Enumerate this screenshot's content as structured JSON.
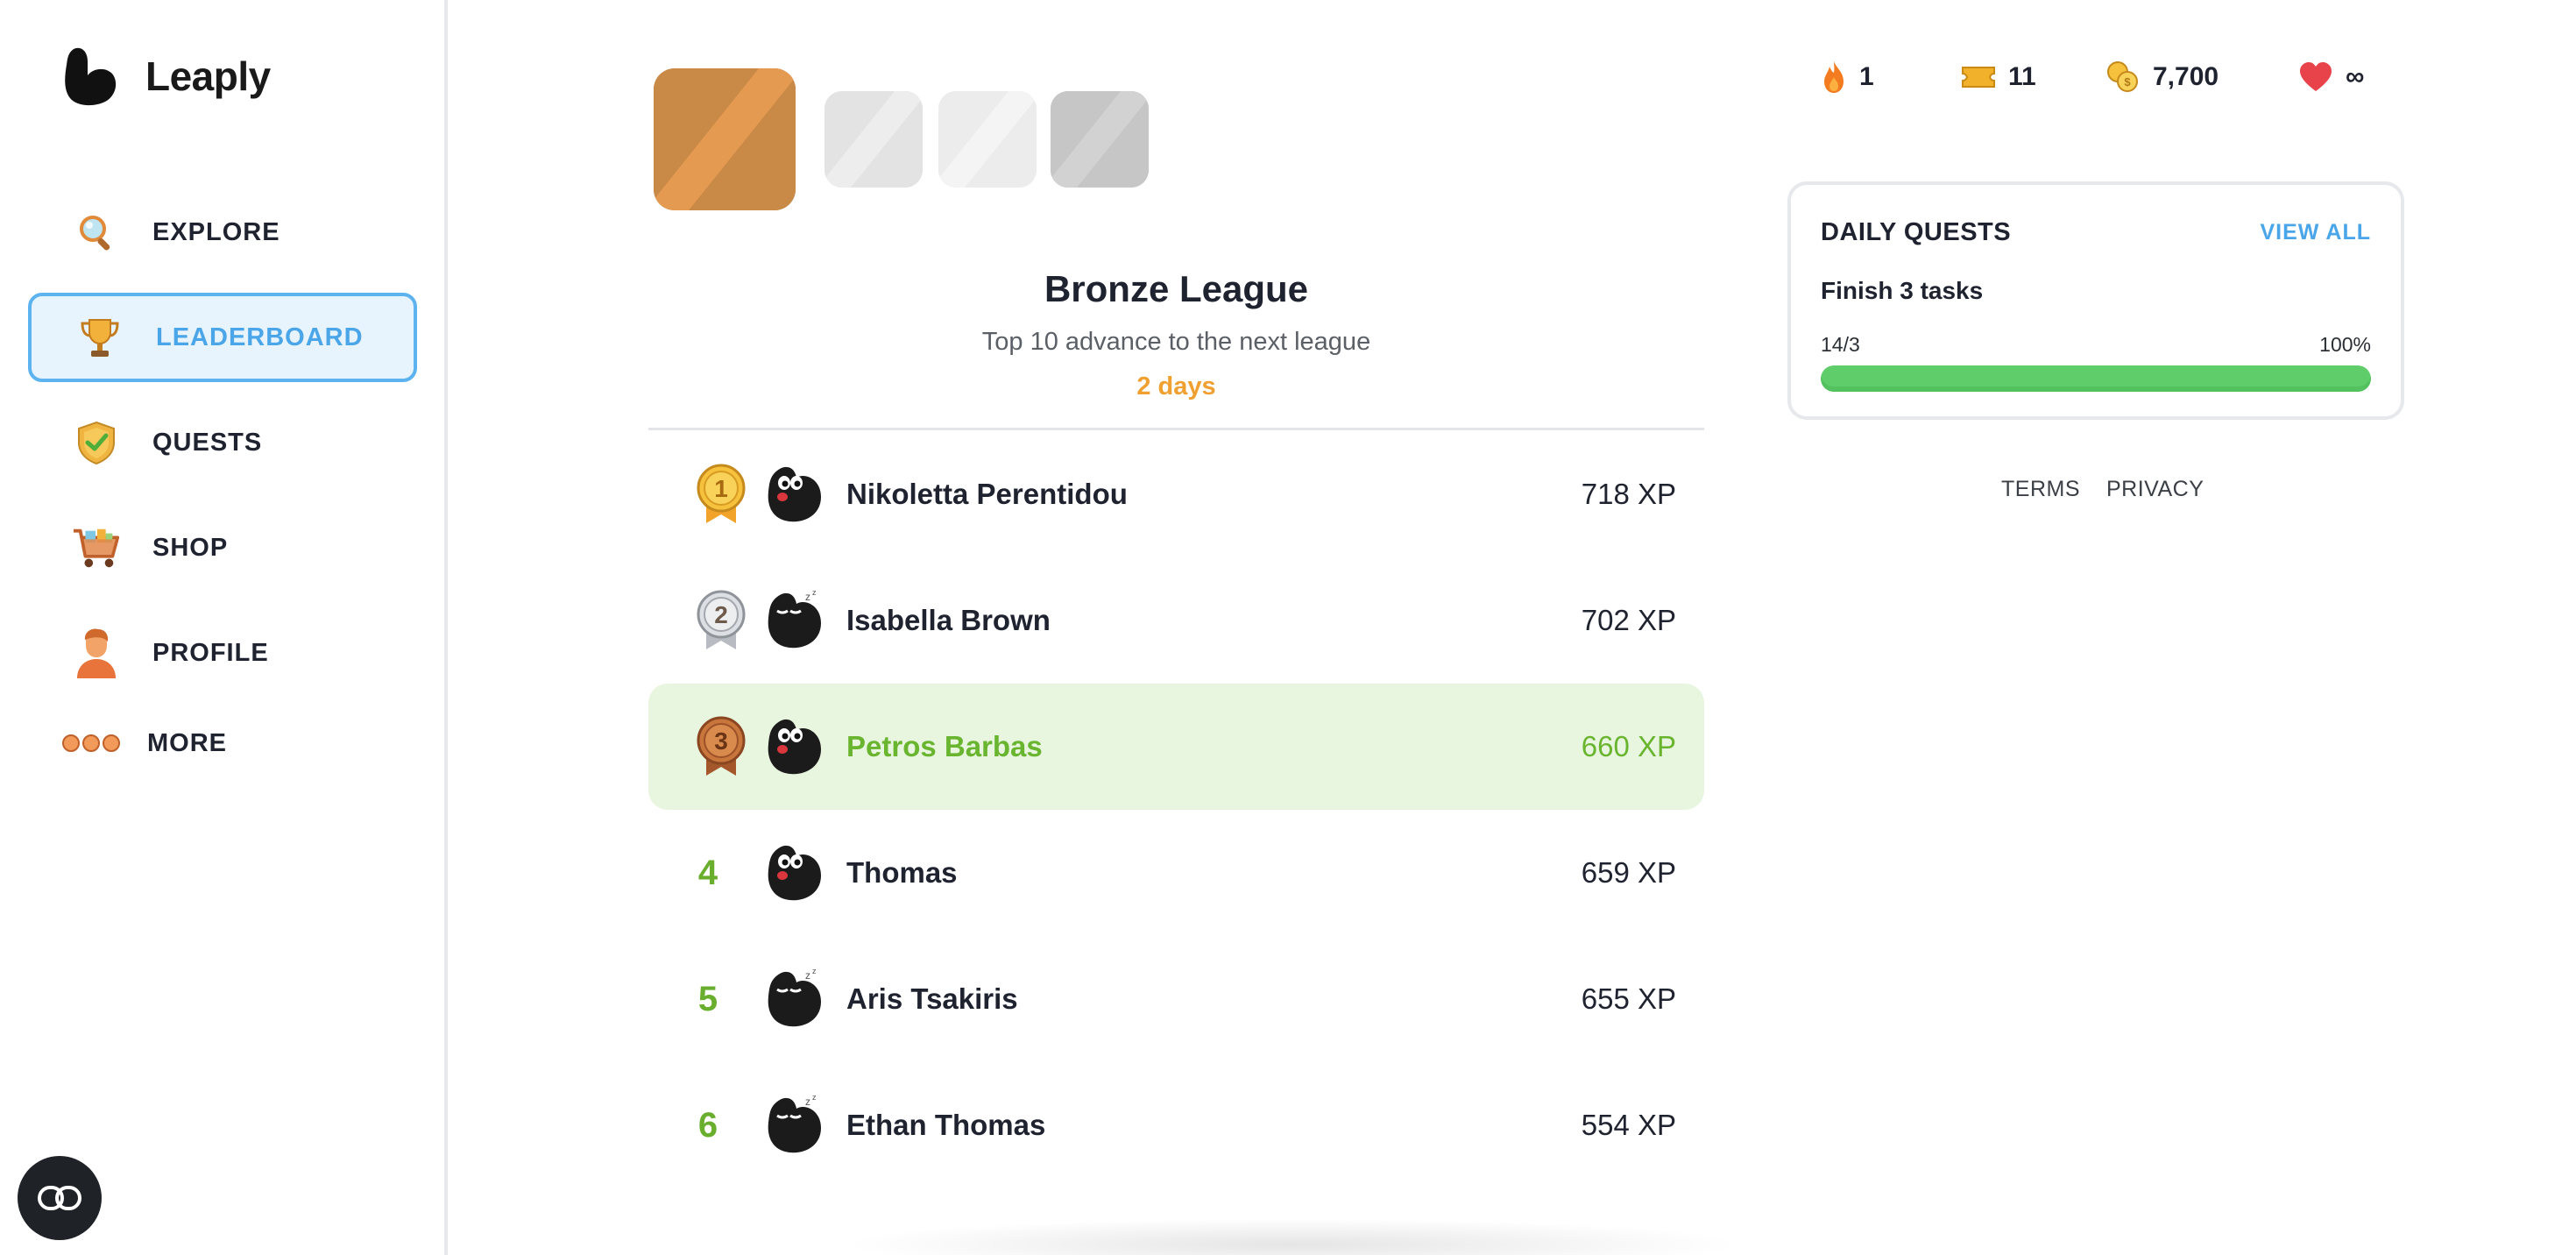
{
  "app": {
    "name": "Leaply"
  },
  "sidebar": {
    "items": [
      {
        "label": "EXPLORE",
        "icon": "magnifier-icon"
      },
      {
        "label": "LEADERBOARD",
        "icon": "trophy-icon",
        "active": true
      },
      {
        "label": "QUESTS",
        "icon": "shield-check-icon"
      },
      {
        "label": "SHOP",
        "icon": "cart-icon"
      },
      {
        "label": "PROFILE",
        "icon": "person-icon"
      },
      {
        "label": "MORE",
        "icon": "dots-icon"
      }
    ]
  },
  "league": {
    "title": "Bronze League",
    "subtitle": "Top 10 advance to the next league",
    "time_left": "2 days"
  },
  "leaderboard": [
    {
      "rank": "1",
      "name": "Nikoletta Perentidou",
      "xp": "718 XP",
      "medal": "gold"
    },
    {
      "rank": "2",
      "name": "Isabella Brown",
      "xp": "702 XP",
      "medal": "silver"
    },
    {
      "rank": "3",
      "name": "Petros Barbas",
      "xp": "660 XP",
      "medal": "bronze",
      "current_user": true
    },
    {
      "rank": "4",
      "name": "Thomas",
      "xp": "659 XP"
    },
    {
      "rank": "5",
      "name": "Aris Tsakiris",
      "xp": "655 XP"
    },
    {
      "rank": "6",
      "name": "Ethan Thomas",
      "xp": "554 XP"
    }
  ],
  "stats": {
    "streak": "1",
    "tickets": "11",
    "coins": "7,700",
    "hearts": "∞"
  },
  "daily_quests": {
    "title": "DAILY QUESTS",
    "view_all": "VIEW ALL",
    "task": "Finish 3 tasks",
    "progress_text": "14/3",
    "percent_text": "100%",
    "progress": 1.0
  },
  "footer": {
    "terms": "TERMS",
    "privacy": "PRIVACY"
  },
  "colors": {
    "accent_blue": "#4aa6e8",
    "highlight_green": "#6ab530",
    "rank_green": "#6aae2e",
    "days_orange": "#f0a030",
    "bronze": "#c98947"
  }
}
